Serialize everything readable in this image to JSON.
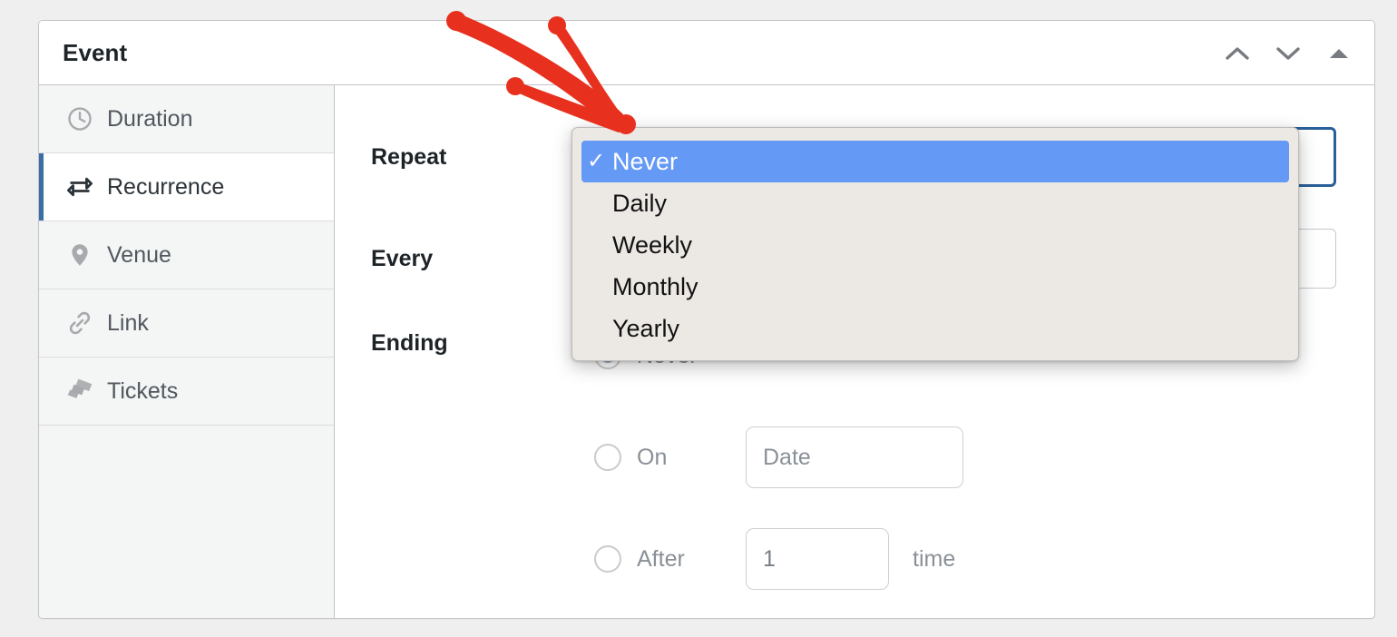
{
  "panel": {
    "title": "Event",
    "header_actions": [
      {
        "name": "move-up-button",
        "icon": "chevron-up-icon"
      },
      {
        "name": "move-down-button",
        "icon": "chevron-down-icon"
      },
      {
        "name": "toggle-panel-button",
        "icon": "triangle-up-icon"
      }
    ]
  },
  "sidebar": {
    "items": [
      {
        "label": "Duration",
        "icon": "clock-icon",
        "active": false
      },
      {
        "label": "Recurrence",
        "icon": "repeat-icon",
        "active": true
      },
      {
        "label": "Venue",
        "icon": "map-pin-icon",
        "active": false
      },
      {
        "label": "Link",
        "icon": "link-icon",
        "active": false
      },
      {
        "label": "Tickets",
        "icon": "tickets-icon",
        "active": false
      }
    ]
  },
  "form": {
    "repeat": {
      "label": "Repeat",
      "value": "Never"
    },
    "every": {
      "label": "Every",
      "value": ""
    },
    "ending": {
      "label": "Ending",
      "options": [
        {
          "label": "Never",
          "checked": true
        },
        {
          "label": "On",
          "checked": false
        },
        {
          "label": "After",
          "checked": false
        }
      ],
      "date_placeholder": "Date",
      "times_value": "1",
      "times_unit": "time"
    }
  },
  "dropdown": {
    "open": true,
    "selected": "Never",
    "items": [
      "Never",
      "Daily",
      "Weekly",
      "Monthly",
      "Yearly"
    ],
    "check_glyph": "✓"
  },
  "annotation": {
    "type": "arrow",
    "color": "#E8301E",
    "points_to": "repeat-select"
  },
  "colors": {
    "accent_blue": "#3a6ea5",
    "highlight_blue": "#6499f5",
    "focus_border": "#2b5f99",
    "annotation_red": "#E8301E",
    "page_bg": "#EFEFEF",
    "panel_bg": "#FFFFFF",
    "sidebar_bg": "#F4F5F5"
  }
}
